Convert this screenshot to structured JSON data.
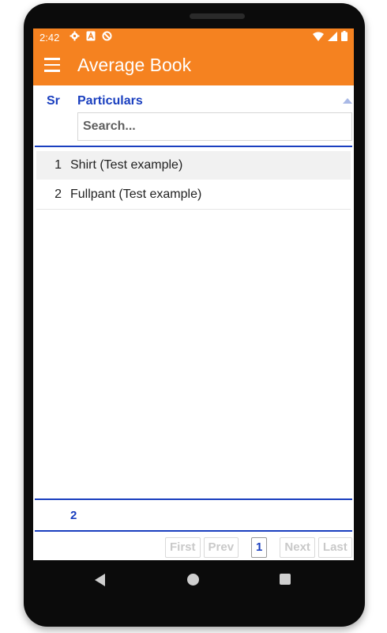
{
  "status_bar": {
    "time": "2:42",
    "left_icons": [
      "gear-icon",
      "a-badge-icon",
      "sync-icon"
    ],
    "right_icons": [
      "wifi-icon",
      "signal-icon",
      "battery-icon"
    ],
    "color": "#f58220"
  },
  "app_bar": {
    "title": "Average Book",
    "menu_icon": "hamburger-menu-icon"
  },
  "table": {
    "columns": {
      "sr": "Sr",
      "particulars": "Particulars"
    },
    "search_placeholder": "Search...",
    "rows": [
      {
        "sr": "1",
        "particulars": "Shirt (Test example)"
      },
      {
        "sr": "2",
        "particulars": "Fullpant (Test example)"
      }
    ],
    "footer_count": "2"
  },
  "pagination": {
    "first": "First",
    "prev": "Prev",
    "current": "1",
    "next": "Next",
    "last": "Last"
  },
  "accent_color": "#1a3fbf"
}
